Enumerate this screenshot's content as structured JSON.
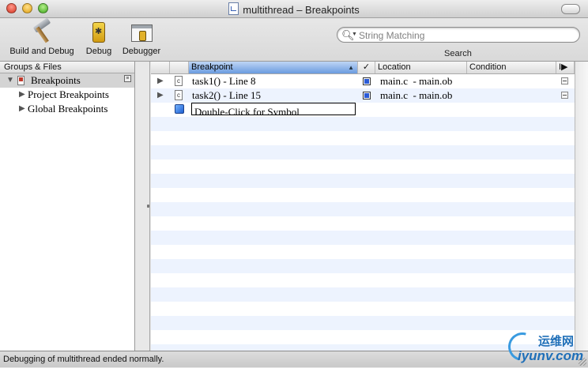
{
  "window": {
    "title": "multithread – Breakpoints"
  },
  "toolbar": {
    "build_and_debug": "Build and Debug",
    "debug": "Debug",
    "debugger": "Debugger",
    "search_placeholder": "String Matching",
    "search_label": "Search"
  },
  "sidebar": {
    "header": "Groups & Files",
    "items": [
      {
        "label": "Breakpoints"
      },
      {
        "label": "Project Breakpoints"
      },
      {
        "label": "Global Breakpoints"
      }
    ]
  },
  "table": {
    "columns": {
      "breakpoint": "Breakpoint",
      "enabled": "✓",
      "location": "Location",
      "condition": "Condition",
      "more": "I▶"
    },
    "rows": [
      {
        "breakpoint": "task1() - Line 8",
        "location": "main.c  - main.ob",
        "file_icon": "c"
      },
      {
        "breakpoint": "task2() - Line 15",
        "location": "main.c  - main.ob",
        "file_icon": "c"
      }
    ],
    "new_row_placeholder": "Double-Click for Symbol"
  },
  "status": {
    "text": "Debugging of multithread ended normally."
  },
  "watermark": {
    "cn": "运维网",
    "domain": "iyunv.com"
  },
  "icons": {
    "build_and_debug": "hammer-icon",
    "debug": "bug-icon",
    "debugger": "debugger-window-icon",
    "search": "search-icon",
    "breakpoint_group": "breakpoints-icon",
    "file": "c-file-icon",
    "symbol": "cube-icon"
  },
  "colors": {
    "selection_header": "#6a9bdf",
    "stripe": "#edf3fe",
    "checkbox": "#2b5bd6"
  }
}
